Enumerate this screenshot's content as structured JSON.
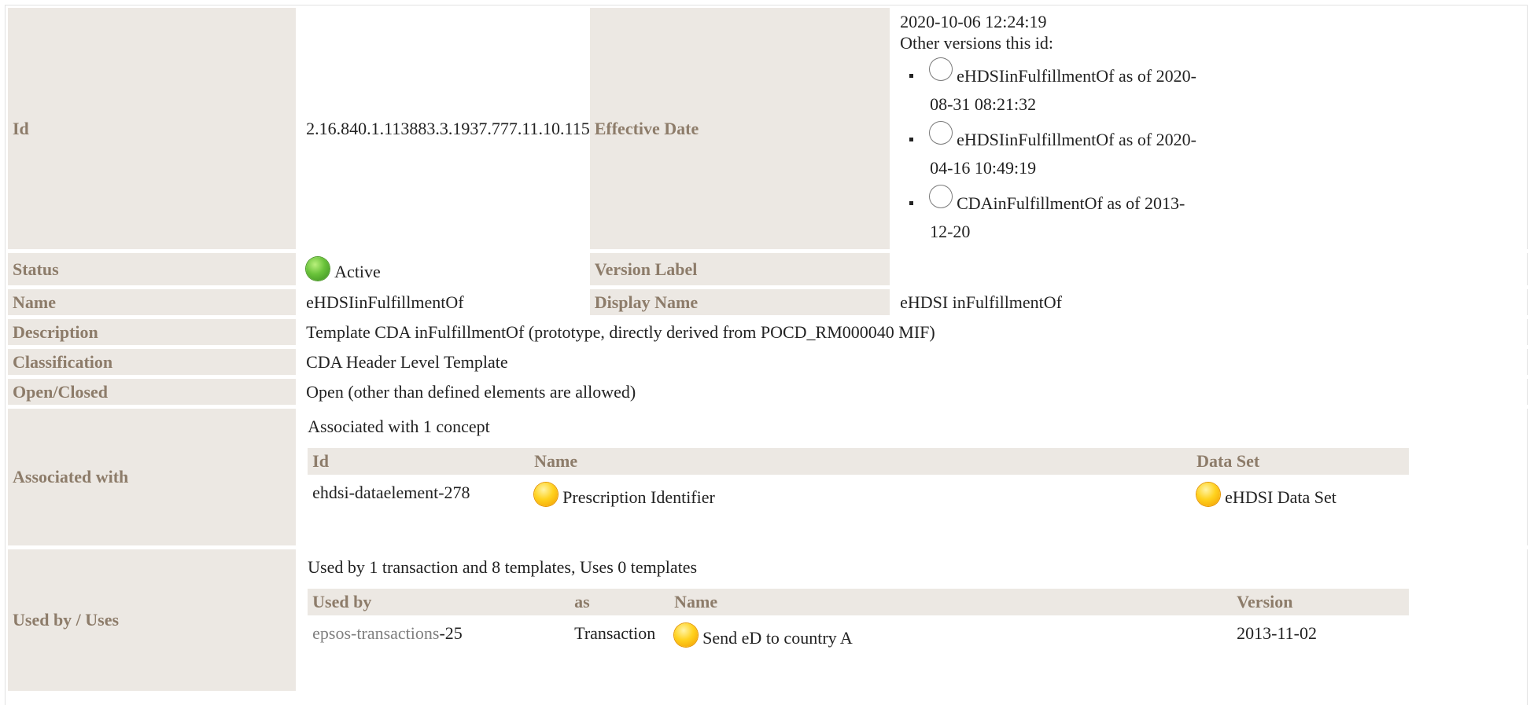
{
  "labels": {
    "id": "Id",
    "effective_date": "Effective Date",
    "status": "Status",
    "version_label": "Version Label",
    "name": "Name",
    "display_name": "Display Name",
    "description": "Description",
    "classification": "Classification",
    "open_closed": "Open/Closed",
    "associated_with": "Associated with",
    "used_by_uses": "Used by / Uses"
  },
  "values": {
    "id": "2.16.840.1.113883.3.1937.777.11.10.115",
    "effective_date": "2020-10-06 12:24:19",
    "other_versions_heading": "Other versions this id:",
    "status": "Active",
    "version_label": "",
    "name": "eHDSIinFulfillmentOf",
    "display_name": "eHDSI inFulfillmentOf",
    "description": "Template CDA inFulfillmentOf (prototype, directly derived from POCD_RM000040 MIF)",
    "classification": "CDA Header Level Template",
    "open_closed": "Open (other than defined elements are allowed)"
  },
  "other_versions": [
    {
      "text": "eHDSIinFulfillmentOf as of 2020-08-31 08:21:32"
    },
    {
      "text": "eHDSIinFulfillmentOf as of 2020-04-16 10:49:19"
    },
    {
      "text": "CDAinFulfillmentOf as of 2013-12-20"
    }
  ],
  "associated": {
    "intro": "Associated with 1 concept",
    "headers": {
      "id": "Id",
      "name": "Name",
      "data_set": "Data Set"
    },
    "rows": [
      {
        "id": "ehdsi-dataelement-278",
        "name": "Prescription Identifier",
        "data_set": "eHDSI Data Set"
      }
    ]
  },
  "usedby": {
    "intro": "Used by 1 transaction and 8 templates, Uses 0 templates",
    "headers": {
      "used_by": "Used by",
      "as": "as",
      "name": "Name",
      "version": "Version"
    },
    "rows": [
      {
        "used_by_prefix": "epsos-transactions",
        "used_by_suffix": "-25",
        "as": "Transaction",
        "name": "Send eD to country A",
        "version": "2013-11-02"
      }
    ]
  },
  "colors": {
    "label_bg": "#ece8e3",
    "label_text": "#8d7c6a",
    "status_active": "#69c23a",
    "status_draft": "#ffd21f"
  },
  "icons": {
    "status_active": "green-circle-icon",
    "status_draft": "yellow-circle-icon",
    "version_radio": "empty-circle-icon"
  }
}
